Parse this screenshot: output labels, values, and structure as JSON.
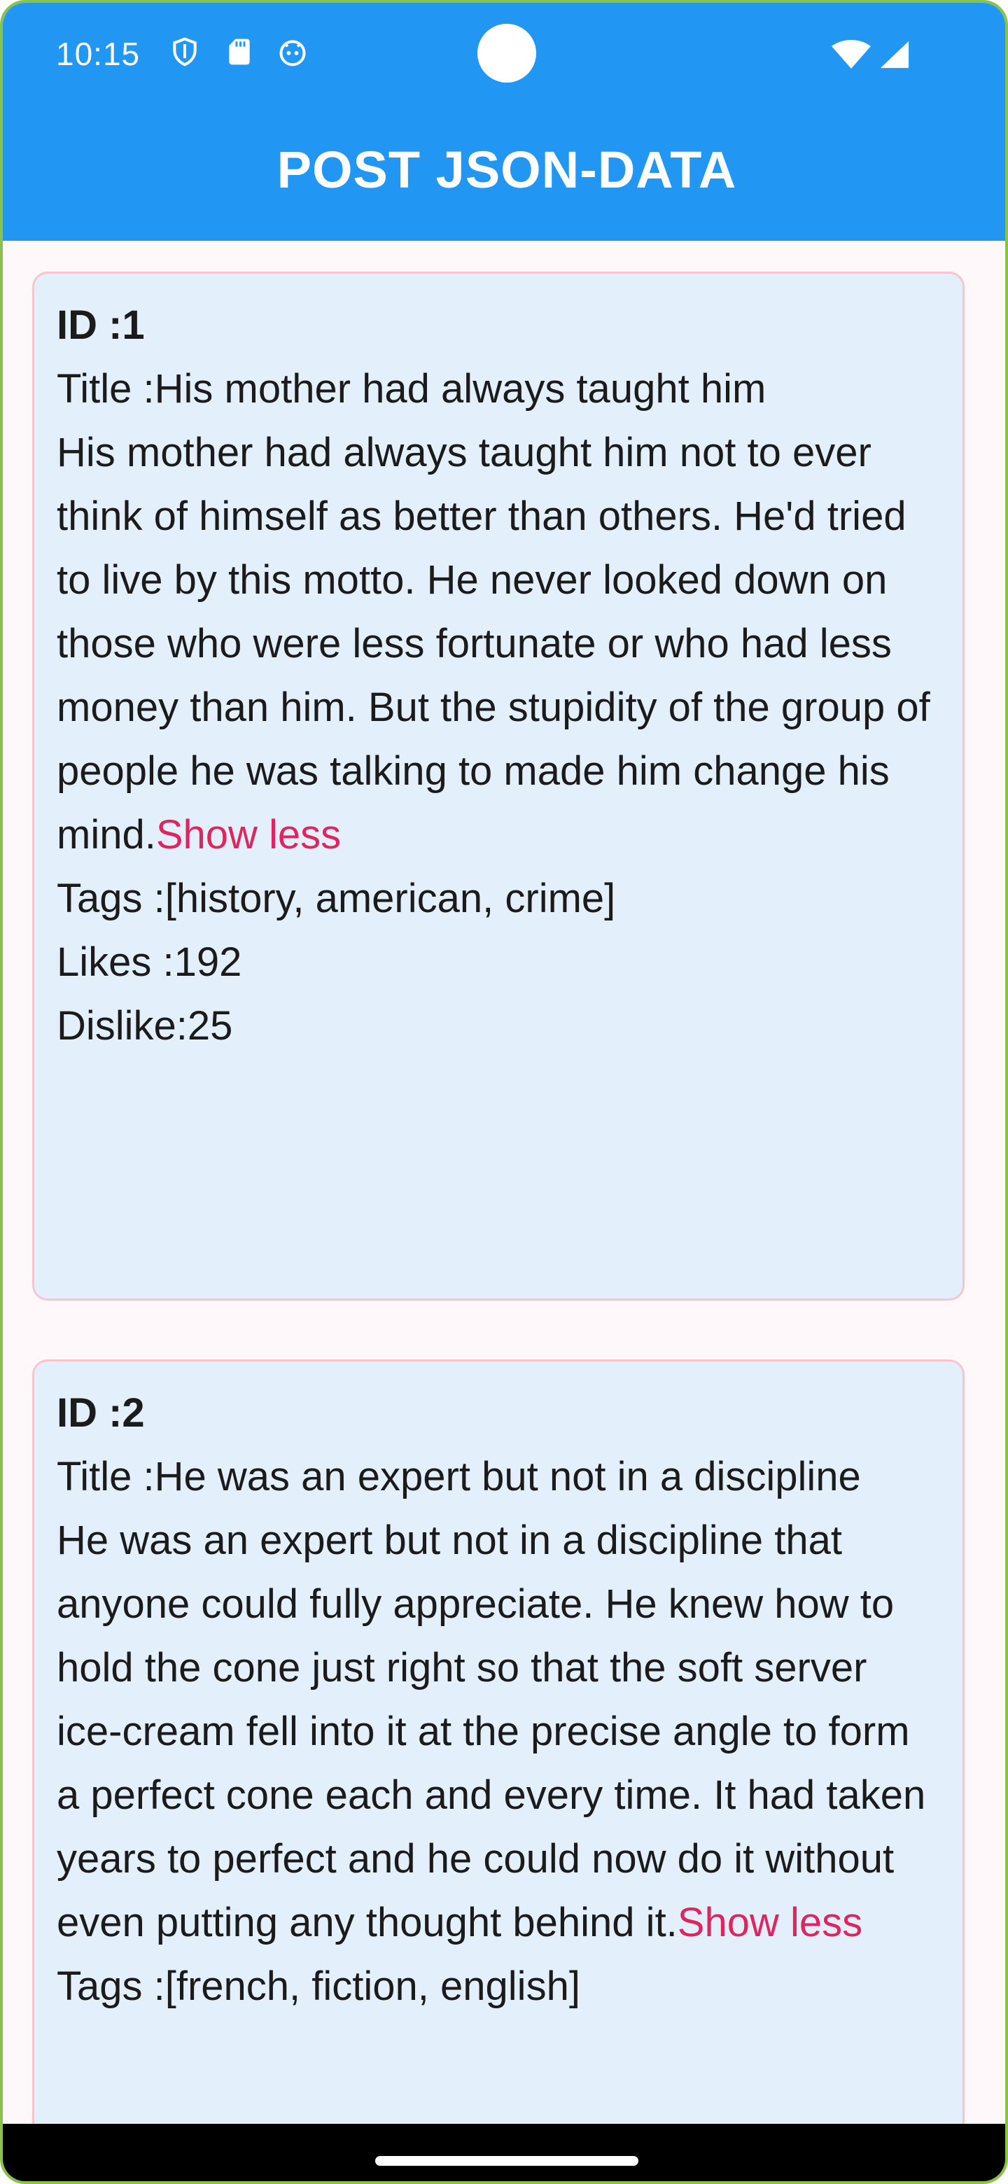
{
  "status_bar": {
    "time": "10:15",
    "icons": [
      "shield-icon",
      "sd-card-icon",
      "robot-icon",
      "wifi-icon",
      "signal-icon"
    ]
  },
  "app_bar": {
    "title": "POST JSON-DATA"
  },
  "posts": [
    {
      "id_text": "ID :1",
      "title_text": "Title :His mother had always taught him",
      "body": "His mother had always taught him not to ever think of himself as better than others. He'd tried to live by this motto. He never looked down on those who were less fortunate or who had less money than him. But the stupidity of the group of people he was talking to made him change his mind.",
      "show_less": "Show less",
      "tags_text": "Tags :[history, american, crime]",
      "likes_text": "Likes :192",
      "dislike_text": "Dislike:25"
    },
    {
      "id_text": "ID :2",
      "title_text": "Title :He was an expert but not in a discipline",
      "body": "He was an expert but not in a discipline that anyone could fully appreciate. He knew how to hold the cone just right so that the soft server ice-cream fell into it at the precise angle to form a perfect cone each and every time. It had taken years to perfect and he could now do it without even putting any thought behind it.",
      "show_less": "Show less",
      "tags_text": "Tags :[french, fiction, english]"
    }
  ],
  "colors": {
    "app_bar": "#2196f3",
    "card_background": "#e3f0fb",
    "card_border": "#f7c6cd",
    "link": "#e0245e"
  }
}
